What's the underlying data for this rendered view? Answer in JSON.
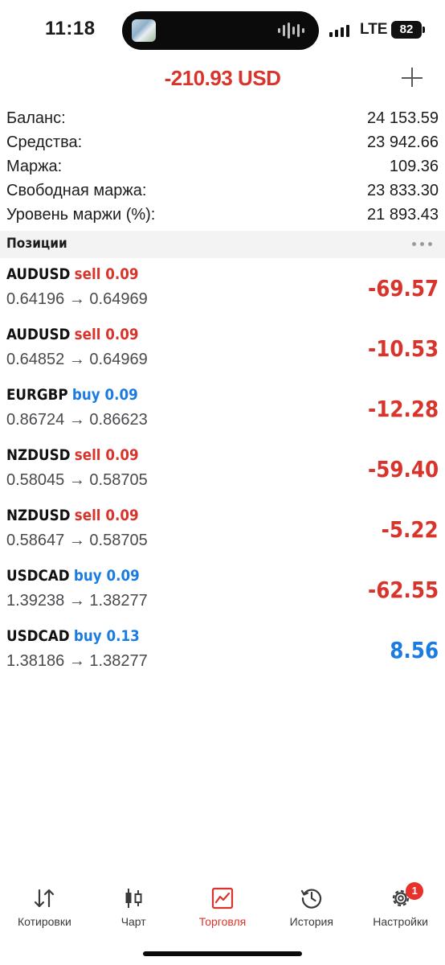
{
  "status_bar": {
    "time": "11:18",
    "network": "LTE",
    "battery": "82"
  },
  "header": {
    "total_profit": "-210.93 USD"
  },
  "summary": [
    {
      "label": "Баланс:",
      "value": "24 153.59"
    },
    {
      "label": "Средства:",
      "value": "23 942.66"
    },
    {
      "label": "Маржа:",
      "value": "109.36"
    },
    {
      "label": "Свободная маржа:",
      "value": "23 833.30"
    },
    {
      "label": "Уровень маржи (%):",
      "value": "21 893.43"
    }
  ],
  "positions_section": {
    "title": "Позиции"
  },
  "positions": [
    {
      "symbol": "AUDUSD",
      "side": "sell",
      "volume": "0.09",
      "open_price": "0.64196",
      "current_price": "0.64969",
      "profit": "-69.57",
      "profit_color": "#d9342b"
    },
    {
      "symbol": "AUDUSD",
      "side": "sell",
      "volume": "0.09",
      "open_price": "0.64852",
      "current_price": "0.64969",
      "profit": "-10.53",
      "profit_color": "#d9342b"
    },
    {
      "symbol": "EURGBP",
      "side": "buy",
      "volume": "0.09",
      "open_price": "0.86724",
      "current_price": "0.86623",
      "profit": "-12.28",
      "profit_color": "#d9342b"
    },
    {
      "symbol": "NZDUSD",
      "side": "sell",
      "volume": "0.09",
      "open_price": "0.58045",
      "current_price": "0.58705",
      "profit": "-59.40",
      "profit_color": "#d9342b"
    },
    {
      "symbol": "NZDUSD",
      "side": "sell",
      "volume": "0.09",
      "open_price": "0.58647",
      "current_price": "0.58705",
      "profit": "-5.22",
      "profit_color": "#d9342b"
    },
    {
      "symbol": "USDCAD",
      "side": "buy",
      "volume": "0.09",
      "open_price": "1.39238",
      "current_price": "1.38277",
      "profit": "-62.55",
      "profit_color": "#d9342b"
    },
    {
      "symbol": "USDCAD",
      "side": "buy",
      "volume": "0.13",
      "open_price": "1.38186",
      "current_price": "1.38277",
      "profit": "8.56",
      "profit_color": "#1a7be0"
    }
  ],
  "colors": {
    "loss": "#d9342b",
    "profit": "#1a7be0",
    "accent": "#d9342b"
  },
  "tabbar": {
    "tabs": [
      {
        "label": "Котировки",
        "icon": "quotes-arrows-icon"
      },
      {
        "label": "Чарт",
        "icon": "candlestick-chart-icon"
      },
      {
        "label": "Торговля",
        "icon": "trade-chart-icon",
        "active": true
      },
      {
        "label": "История",
        "icon": "history-clock-icon"
      },
      {
        "label": "Настройки",
        "icon": "gear-icon",
        "badge": "1"
      }
    ]
  }
}
